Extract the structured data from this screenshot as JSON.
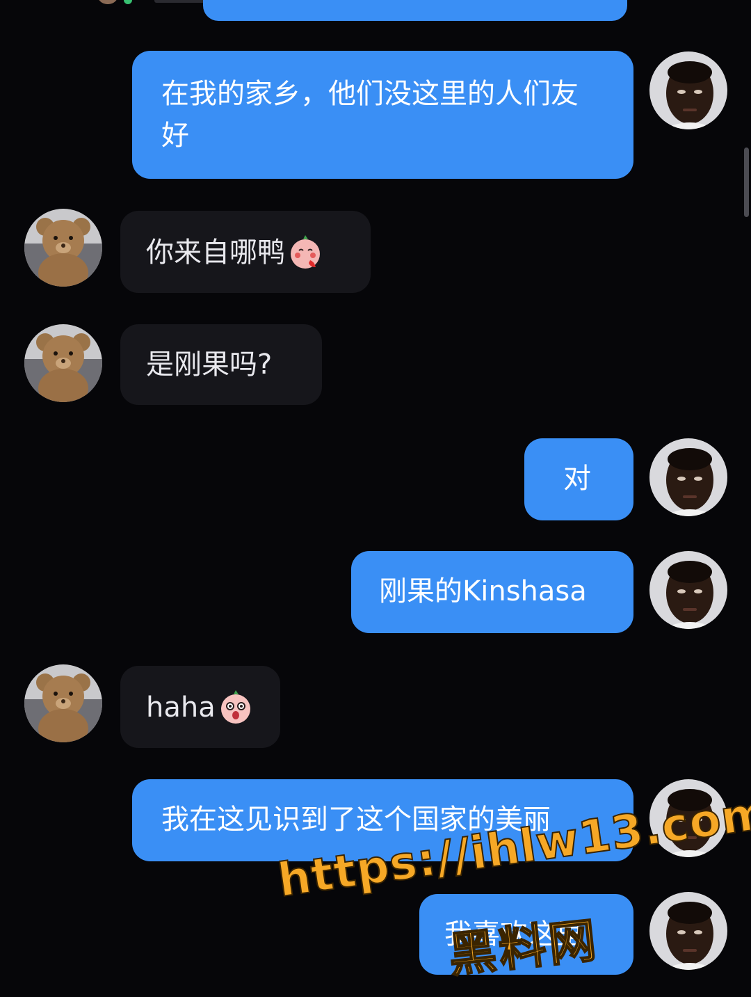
{
  "messages": [
    {
      "id": "m1",
      "side": "out",
      "text": "在我的家乡，他们没这里的人们友好",
      "avatar_icon": "person-avatar-icon"
    },
    {
      "id": "m2",
      "side": "in",
      "text": "你来自哪鸭",
      "emoji": "blush-peach-emoji-icon",
      "avatar_icon": "teddy-bear-avatar-icon"
    },
    {
      "id": "m3",
      "side": "in",
      "text": "是刚果吗?",
      "avatar_icon": "teddy-bear-avatar-icon"
    },
    {
      "id": "m4",
      "side": "out",
      "text": "对",
      "avatar_icon": "person-avatar-icon"
    },
    {
      "id": "m5",
      "side": "out",
      "text": "刚果的Kinshasa",
      "avatar_icon": "person-avatar-icon"
    },
    {
      "id": "m6",
      "side": "in",
      "text": "haha",
      "emoji": "surprised-peach-emoji-icon",
      "avatar_icon": "teddy-bear-avatar-icon"
    },
    {
      "id": "m7",
      "side": "out",
      "text": "我在这见识到了这个国家的美丽",
      "avatar_icon": "person-avatar-icon"
    },
    {
      "id": "m8",
      "side": "out",
      "text": "我喜欢这里",
      "avatar_icon": "person-avatar-icon"
    }
  ],
  "watermark": {
    "url": "https://ihlw13.com",
    "site": "黑料网"
  },
  "colors": {
    "background": "#060609",
    "outgoing_bubble": "#3a8ff5",
    "incoming_bubble": "#16161b",
    "watermark": "#f6a826"
  }
}
